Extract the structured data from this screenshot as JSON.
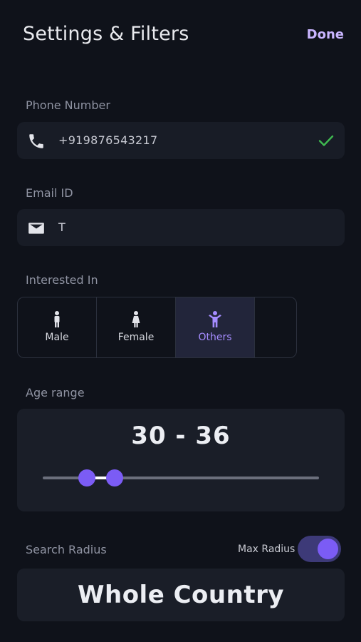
{
  "header": {
    "title": "Settings & Filters",
    "done_label": "Done"
  },
  "phone": {
    "label": "Phone Number",
    "icon": "phone-icon",
    "value": "+919876543217",
    "verified_icon": "checkmark-icon"
  },
  "email": {
    "label": "Email ID",
    "icon": "mail-icon",
    "value": "T"
  },
  "interested_in": {
    "label": "Interested In",
    "options": [
      {
        "label": "Male",
        "icon": "male-icon",
        "selected": false
      },
      {
        "label": "Female",
        "icon": "female-icon",
        "selected": false
      },
      {
        "label": "Others",
        "icon": "others-icon",
        "selected": true
      }
    ]
  },
  "age_range": {
    "label": "Age range",
    "display": "30 - 36",
    "low_fraction": 0.16,
    "high_fraction": 0.26
  },
  "search_radius": {
    "label": "Search Radius",
    "max_radius_label": "Max Radius",
    "max_radius_on": true,
    "value": "Whole Country"
  },
  "colors": {
    "accent": "#7b5cf5",
    "done": "#c9b5ff",
    "verified": "#3fb950",
    "background": "#0f121a",
    "card": "#1a1e28"
  }
}
